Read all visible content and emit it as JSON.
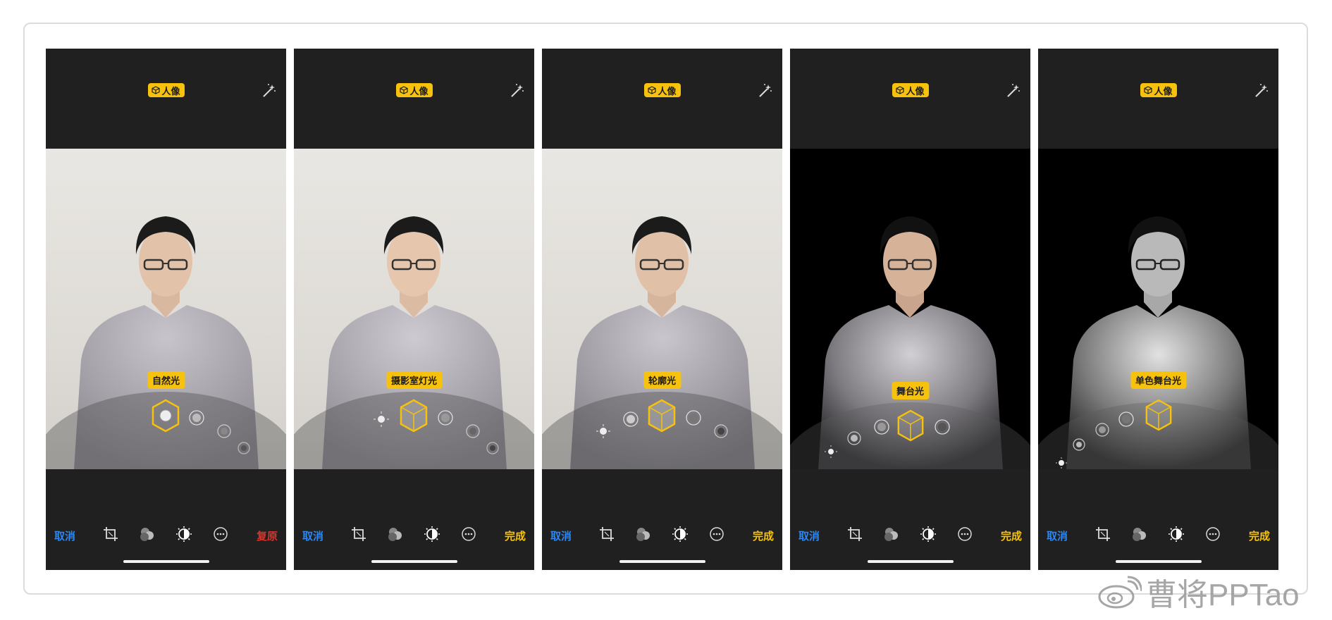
{
  "phones": [
    {
      "badge": "人像",
      "light_label": "自然光",
      "cancel": "取消",
      "right_action": "复原",
      "right_action_color": "#e0312a",
      "photo_style": "light",
      "selected_icon": "natural-light-icon"
    },
    {
      "badge": "人像",
      "light_label": "摄影室灯光",
      "cancel": "取消",
      "right_action": "完成",
      "right_action_color": "#f6c20e",
      "photo_style": "light",
      "selected_icon": "studio-light-icon"
    },
    {
      "badge": "人像",
      "light_label": "轮廓光",
      "cancel": "取消",
      "right_action": "完成",
      "right_action_color": "#f6c20e",
      "photo_style": "light",
      "selected_icon": "contour-light-icon"
    },
    {
      "badge": "人像",
      "light_label": "舞台光",
      "cancel": "取消",
      "right_action": "完成",
      "right_action_color": "#f6c20e",
      "photo_style": "dark",
      "selected_icon": "stage-light-icon"
    },
    {
      "badge": "人像",
      "light_label": "单色舞台光",
      "cancel": "取消",
      "right_action": "完成",
      "right_action_color": "#f6c20e",
      "photo_style": "dark-mono",
      "selected_icon": "stage-light-mono-icon"
    }
  ],
  "toolbar_icons": [
    "crop-icon",
    "filters-icon",
    "adjust-icon",
    "more-icon"
  ],
  "accent_color": "#f6c20e",
  "cancel_color": "#2a86f0",
  "watermark": "曹将PPTao"
}
